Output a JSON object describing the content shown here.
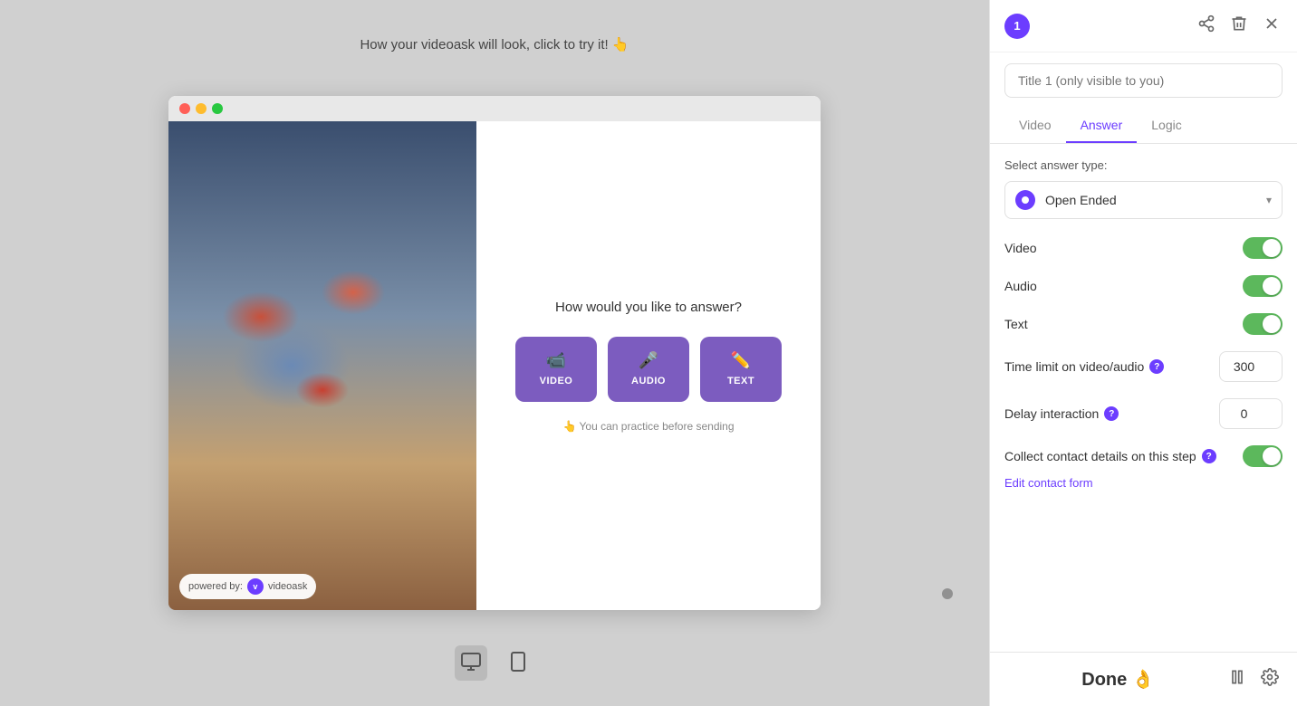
{
  "preview": {
    "hint": "How your videoask will look, click to try it! 👆",
    "dots": [
      "red",
      "yellow",
      "green"
    ],
    "answer_question": "How would you like to answer?",
    "practice_hint": "👆 You can practice before sending",
    "buttons": [
      {
        "id": "video",
        "label": "VIDEO",
        "icon": "🎥"
      },
      {
        "id": "audio",
        "label": "AUDIO",
        "icon": "🎤"
      },
      {
        "id": "text",
        "label": "TEXT",
        "icon": "✏️"
      }
    ],
    "powered_by": "powered by:",
    "videoask_label": "videoask"
  },
  "panel": {
    "step_number": "1",
    "title_placeholder": "Title 1 (only visible to you)",
    "tabs": [
      {
        "id": "video",
        "label": "Video"
      },
      {
        "id": "answer",
        "label": "Answer",
        "active": true
      },
      {
        "id": "logic",
        "label": "Logic"
      }
    ],
    "select_answer_type_label": "Select answer type:",
    "answer_type": "Open Ended",
    "toggles": [
      {
        "id": "video",
        "label": "Video",
        "state": "on"
      },
      {
        "id": "audio",
        "label": "Audio",
        "state": "on"
      },
      {
        "id": "text",
        "label": "Text",
        "state": "on"
      }
    ],
    "time_limit_label": "Time limit on video/audio",
    "time_limit_value": "300",
    "delay_label": "Delay interaction",
    "delay_value": "0",
    "collect_label": "Collect contact details on this step",
    "collect_state": "on",
    "edit_contact_form": "Edit contact form",
    "header_icons": {
      "share": "share",
      "trash": "trash",
      "close": "close"
    },
    "done_label": "Done 👌"
  },
  "view_toggle": {
    "desktop_label": "desktop view",
    "mobile_label": "mobile view"
  },
  "colors": {
    "purple": "#6c3dff",
    "green": "#5cb85c"
  }
}
